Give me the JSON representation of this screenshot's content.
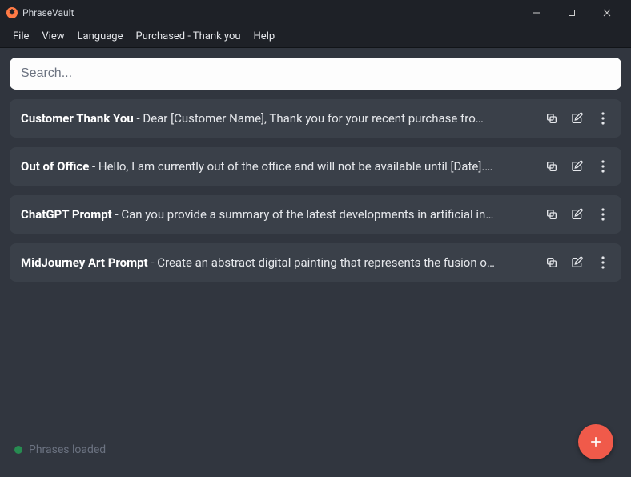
{
  "titlebar": {
    "app_name": "PhraseVault"
  },
  "menu": {
    "items": [
      "File",
      "View",
      "Language",
      "Purchased - Thank you",
      "Help"
    ]
  },
  "search": {
    "placeholder": "Search...",
    "value": ""
  },
  "phrases": [
    {
      "title": "Customer Thank You",
      "body": "Dear [Customer Name], Thank you for your recent purchase fro…"
    },
    {
      "title": "Out of Office",
      "body": "Hello, I am currently out of the office and will not be available until [Date].…"
    },
    {
      "title": "ChatGPT Prompt",
      "body": "Can you provide a summary of the latest developments in artificial in…"
    },
    {
      "title": "MidJourney Art Prompt",
      "body": "Create an abstract digital painting that represents the fusion o…"
    }
  ],
  "status": {
    "text": "Phrases loaded"
  }
}
